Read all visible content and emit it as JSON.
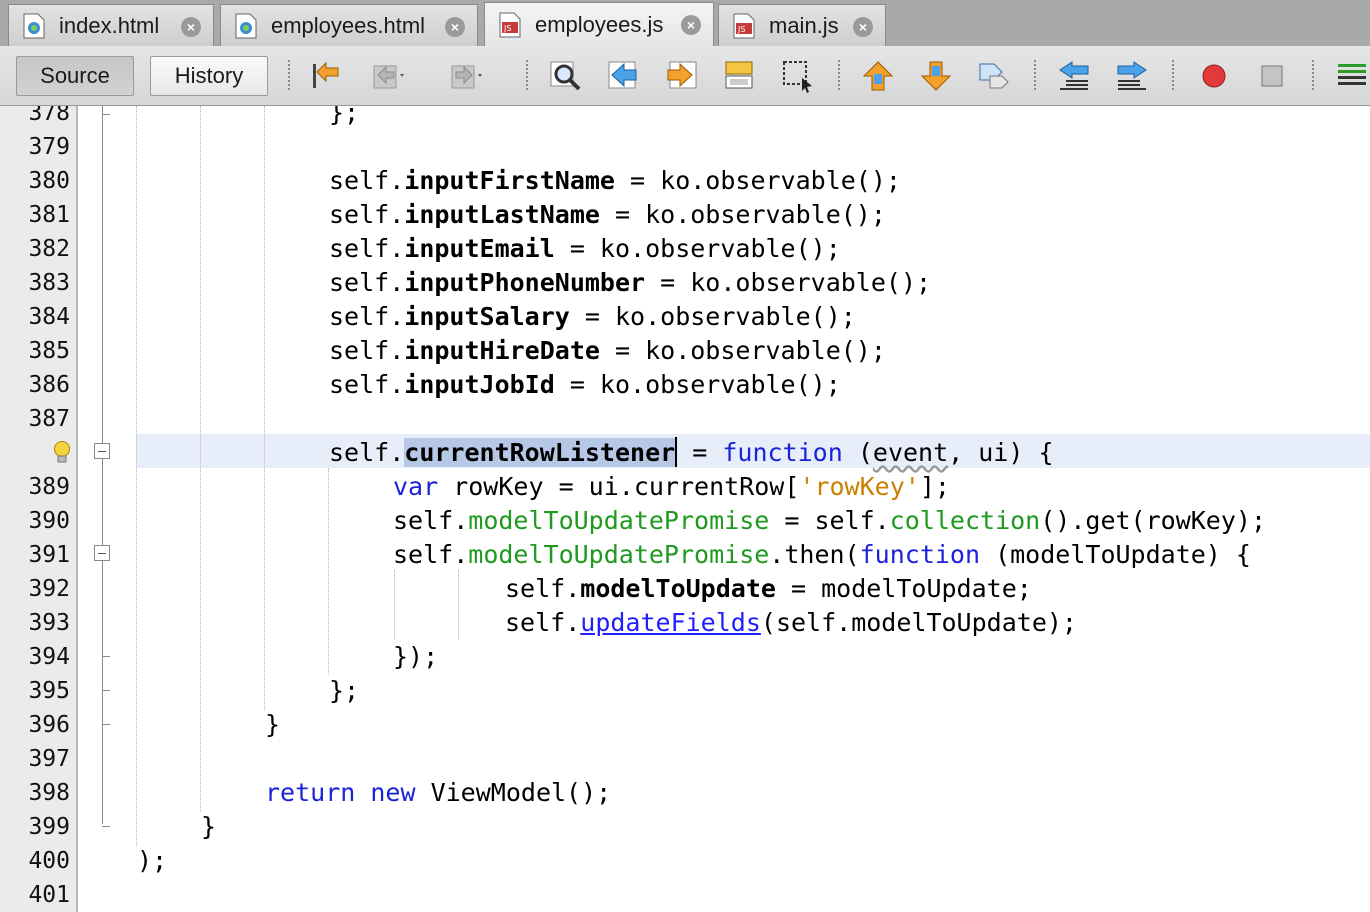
{
  "tabs": [
    {
      "label": "index.html",
      "icon": "html-file-icon",
      "active": false
    },
    {
      "label": "employees.html",
      "icon": "html-file-icon",
      "active": false
    },
    {
      "label": "employees.js",
      "icon": "js-file-icon",
      "active": true
    },
    {
      "label": "main.js",
      "icon": "js-file-icon",
      "active": false
    }
  ],
  "toolbar": {
    "source_label": "Source",
    "history_label": "History",
    "icons": [
      "last-edit-icon",
      "back-icon",
      "forward-icon",
      "find-icon",
      "find-previous-icon",
      "find-next-icon",
      "toggle-highlight-icon",
      "toggle-rectangular-selection-icon",
      "previous-bookmark-icon",
      "next-bookmark-icon",
      "toggle-bookmark-icon",
      "shift-left-icon",
      "shift-right-icon",
      "start-macro-recording-icon",
      "stop-macro-recording-icon",
      "comment-icon"
    ]
  },
  "editor": {
    "line_numbers": [
      "378",
      "379",
      "380",
      "381",
      "382",
      "383",
      "384",
      "385",
      "386",
      "387",
      "388",
      "389",
      "390",
      "391",
      "392",
      "393",
      "394",
      "395",
      "396",
      "397",
      "398",
      "399",
      "400",
      "401"
    ],
    "current_line": "388",
    "lines": {
      "l378": "};",
      "l380_obj": "self.",
      "l380_fld": "inputFirstName",
      "l380_rest": " = ko.observable();",
      "l381_obj": "self.",
      "l381_fld": "inputLastName",
      "l381_rest": " = ko.observable();",
      "l382_obj": "self.",
      "l382_fld": "inputEmail",
      "l382_rest": " = ko.observable();",
      "l383_obj": "self.",
      "l383_fld": "inputPhoneNumber",
      "l383_rest": " = ko.observable();",
      "l384_obj": "self.",
      "l384_fld": "inputSalary",
      "l384_rest": " = ko.observable();",
      "l385_obj": "self.",
      "l385_fld": "inputHireDate",
      "l385_rest": " = ko.observable();",
      "l386_obj": "self.",
      "l386_fld": "inputJobId",
      "l386_rest": " = ko.observable();",
      "l388_obj": "self.",
      "l388_sel": "currentRowListener",
      "l388_eq": " = ",
      "l388_kw": "function",
      "l388_a": " (",
      "l388_ev": "event",
      "l388_b": ", ui) {",
      "l389_kw": "var",
      "l389_a": " rowKey = ui.currentRow[",
      "l389_str": "'rowKey'",
      "l389_b": "];",
      "l390_a": "self.",
      "l390_mem": "modelToUpdatePromise",
      "l390_b": " = self.",
      "l390_mem2": "collection",
      "l390_c": "().get(rowKey);",
      "l391_a": "self.",
      "l391_mem": "modelToUpdatePromise",
      "l391_b": ".then(",
      "l391_kw": "function",
      "l391_c": " (modelToUpdate) {",
      "l392_a": "self.",
      "l392_fld": "modelToUpdate",
      "l392_b": " = modelToUpdate;",
      "l393_a": "self.",
      "l393_lnk": "updateFields",
      "l393_b": "(self.modelToUpdate);",
      "l394": "});",
      "l395": "};",
      "l396": "}",
      "l398_kw1": "return",
      "l398_sp": " ",
      "l398_kw2": "new",
      "l398_rest": " ViewModel();",
      "l399": "}",
      "l400": ");"
    }
  }
}
